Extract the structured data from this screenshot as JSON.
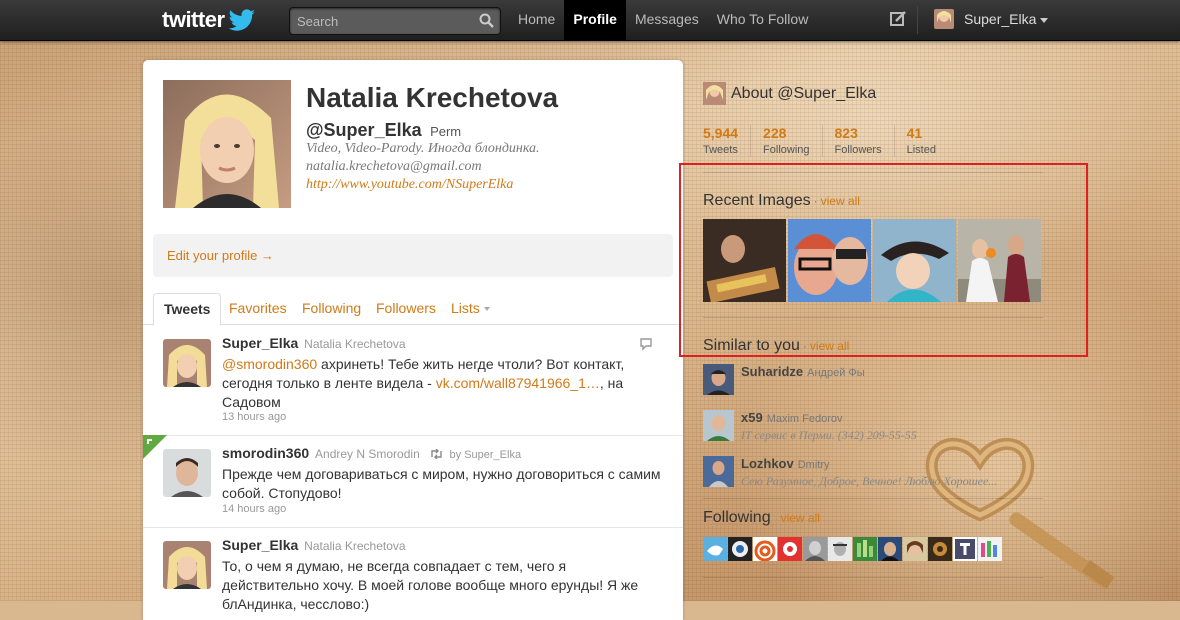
{
  "brand": {
    "logo_text": "twitter"
  },
  "search": {
    "placeholder": "Search"
  },
  "nav": {
    "items": [
      {
        "label": "Home"
      },
      {
        "label": "Profile"
      },
      {
        "label": "Messages"
      },
      {
        "label": "Who To Follow"
      }
    ],
    "active": "Profile",
    "username": "Super_Elka"
  },
  "profile": {
    "name": "Natalia Krechetova",
    "handle": "@Super_Elka",
    "location": "Perm",
    "bio": "Video, Video-Parody. Иногда блондинка.",
    "email": "natalia.krechetova@gmail.com",
    "url": "http://www.youtube.com/NSuperElka",
    "edit_label": "Edit your profile →"
  },
  "tabs": [
    {
      "label": "Tweets"
    },
    {
      "label": "Favorites"
    },
    {
      "label": "Following"
    },
    {
      "label": "Followers"
    },
    {
      "label": "Lists"
    }
  ],
  "tweets": [
    {
      "user": "Super_Elka",
      "fullname": "Natalia Krechetova",
      "mention": "@smorodin360",
      "text_a": " ахринеть! Тебе жить негде чтоли? Вот контакт, сегодня только в ленте видела - ",
      "link": "vk.com/wall87941966_1…",
      "text_b": ", на Садовом",
      "time": "13 hours ago"
    },
    {
      "user": "smorodin360",
      "fullname": "Andrey N Smorodin",
      "retweeted_by": "by Super_Elka",
      "text": "Прежде чем договариваться с миром, нужно договориться с самим собой. Стопудово!",
      "time": "14 hours ago"
    },
    {
      "user": "Super_Elka",
      "fullname": "Natalia Krechetova",
      "text": "То, о чем я думаю, не всегда совпадает с тем, чего я действительно хочу. В моей голове вообще много ерунды! Я же блАндинка, чесслово:)"
    }
  ],
  "sidebar": {
    "about": "About @Super_Elka",
    "stats": [
      {
        "num": "5,944",
        "label": "Tweets"
      },
      {
        "num": "228",
        "label": "Following"
      },
      {
        "num": "823",
        "label": "Followers"
      },
      {
        "num": "41",
        "label": "Listed"
      }
    ],
    "recent_images_title": "Recent Images",
    "similar_title": "Similar to you",
    "following_title": "Following",
    "view_all": "view all",
    "dot": "·",
    "similar": [
      {
        "user": "Suharidze",
        "name": "Андрей Фы",
        "bio": ""
      },
      {
        "user": "x59",
        "name": "Maxim Fedorov",
        "bio": "IT сервис в Перми. (342) 209-55-55"
      },
      {
        "user": "Lozhkov",
        "name": "Dmitry",
        "bio": "Сею Разумное, Доброе, Вечное! Люблю Хорошее..."
      }
    ]
  },
  "colors": {
    "accent": "#d07a18",
    "topbar": "#222222",
    "highlight": "#e02020"
  }
}
